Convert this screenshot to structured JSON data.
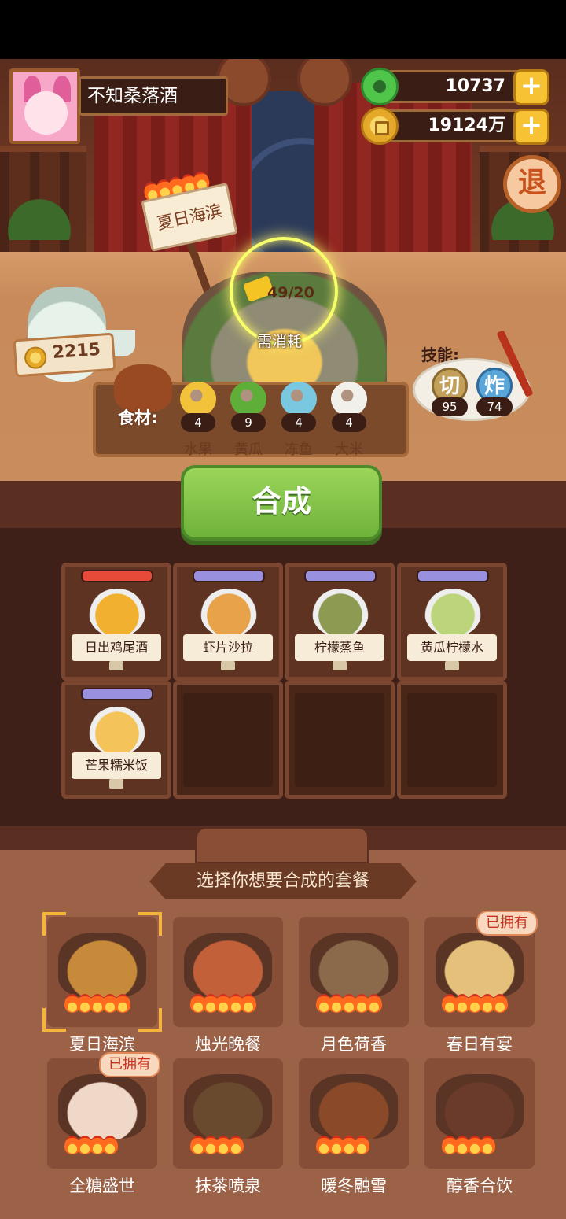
{
  "player": {
    "name": "不知桑落酒"
  },
  "currency": {
    "jade": "10737",
    "coins": "19124万"
  },
  "quit_label": "退",
  "current_set": {
    "name": "夏日海滨",
    "flames": 5
  },
  "cost": {
    "progress": "49/20",
    "label": "需消耗"
  },
  "bank": {
    "coins": "2215"
  },
  "ingredients": {
    "title": "食材:",
    "items": [
      {
        "name": "水果",
        "count": "4",
        "icon": "fruit-icon",
        "color": "#f2c23a"
      },
      {
        "name": "黄瓜",
        "count": "9",
        "icon": "cucumber-icon",
        "color": "#5fae3a"
      },
      {
        "name": "冻鱼",
        "count": "4",
        "icon": "frozen-fish-icon",
        "color": "#7ac8e0"
      },
      {
        "name": "大米",
        "count": "4",
        "icon": "rice-icon",
        "color": "#f2f0ea"
      }
    ]
  },
  "skills": {
    "title": "技能:",
    "items": [
      {
        "glyph": "切",
        "value": "95"
      },
      {
        "glyph": "炸",
        "value": "74"
      }
    ]
  },
  "combine_label": "合成",
  "dishes": [
    {
      "name": "日出鸡尾酒",
      "bar": "#e84a3a",
      "color": "#f2b030"
    },
    {
      "name": "虾片沙拉",
      "bar": "#9a90e0",
      "color": "#e8a24a"
    },
    {
      "name": "柠檬蒸鱼",
      "bar": "#9a90e0",
      "color": "#8c9a52"
    },
    {
      "name": "黄瓜柠檬水",
      "bar": "#9a90e0",
      "color": "#bcd47a"
    },
    {
      "name": "芒果糯米饭",
      "bar": "#9a90e0",
      "color": "#f4c45a"
    }
  ],
  "choose_title": "选择你想要合成的套餐",
  "sets": [
    {
      "name": "夏日海滨",
      "flames": 5,
      "owned": false,
      "selected": true,
      "color": "#c78a3a"
    },
    {
      "name": "烛光晚餐",
      "flames": 5,
      "owned": false,
      "selected": false,
      "color": "#c2603a"
    },
    {
      "name": "月色荷香",
      "flames": 5,
      "owned": false,
      "selected": false,
      "color": "#8a6a4a"
    },
    {
      "name": "春日有宴",
      "flames": 5,
      "owned": true,
      "selected": false,
      "color": "#e4c07a"
    },
    {
      "name": "全糖盛世",
      "flames": 4,
      "owned": true,
      "selected": false,
      "color": "#f0d8c8"
    },
    {
      "name": "抹茶喷泉",
      "flames": 4,
      "owned": false,
      "selected": false,
      "color": "#6a4a2e"
    },
    {
      "name": "暖冬融雪",
      "flames": 4,
      "owned": false,
      "selected": false,
      "color": "#8a4a2a"
    },
    {
      "name": "醇香合饮",
      "flames": 4,
      "owned": false,
      "selected": false,
      "color": "#6a3a2a"
    }
  ],
  "owned_label": "已拥有"
}
